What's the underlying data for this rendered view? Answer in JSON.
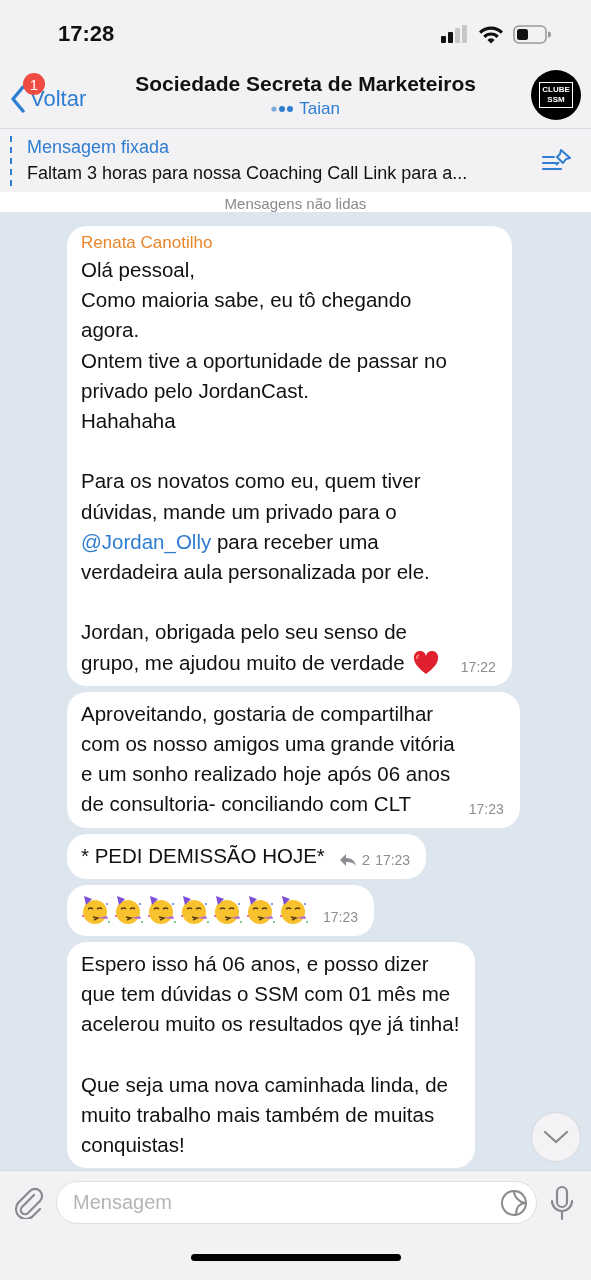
{
  "status_bar": {
    "time": "17:28"
  },
  "header": {
    "back_label": "Voltar",
    "unread_badge": "1",
    "title": "Sociedade Secreta de Marketeiros",
    "typing_user": "Taian",
    "avatar_text": "CLUBE SSM"
  },
  "pinned": {
    "label": "Mensagem fixada",
    "text": "Faltam 3 horas para nossa Coaching Call Link para a..."
  },
  "unread_divider": "Mensagens não lidas",
  "messages": [
    {
      "kind": "text",
      "sender": "Renata Canotilho",
      "paragraphs": [
        [
          {
            "kind": "plain",
            "text": "Olá pessoal,\nComo maioria sabe, eu tô chegando\nagora.\nOntem tive a oportunidade de passar no\nprivado pelo JordanCast.\nHahahaha"
          }
        ],
        [
          {
            "kind": "plain",
            "text": "Para os novatos como eu, quem tiver\ndúvidas, mande um privado para o\n"
          },
          {
            "kind": "mention",
            "text": "@Jordan_Olly"
          },
          {
            "kind": "plain",
            "text": " para receber uma\nverdadeira aula personalizada por ele."
          }
        ],
        [
          {
            "kind": "plain",
            "text": "Jordan, obrigada pelo seu senso de\ngrupo, me ajudou muito de verdade"
          }
        ]
      ],
      "trailing_emoji": {
        "kind": "heart"
      },
      "time": "17:22"
    },
    {
      "kind": "text",
      "paragraphs": [
        [
          {
            "kind": "plain",
            "text": "Aproveitando, gostaria de compartilhar\ncom os nosso amigos uma grande vitória\ne um sonho realizado hoje após 06 anos\nde consultoria- conciliando com CLT"
          }
        ]
      ],
      "time": "17:23"
    },
    {
      "kind": "text",
      "paragraphs": [
        [
          {
            "kind": "plain",
            "text": "* PEDI DEMISSÃO HOJE*"
          }
        ]
      ],
      "replies": "2",
      "time": "17:23"
    },
    {
      "kind": "emoji",
      "emojis": [
        {
          "kind": "party-face"
        },
        {
          "kind": "party-face"
        },
        {
          "kind": "party-face"
        },
        {
          "kind": "party-face"
        },
        {
          "kind": "party-face"
        },
        {
          "kind": "party-face"
        },
        {
          "kind": "party-face"
        }
      ],
      "time": "17:23"
    },
    {
      "kind": "text",
      "paragraphs": [
        [
          {
            "kind": "plain",
            "text": "Espero isso há 06 anos, e posso dizer\nque tem dúvidas o SSM com 01 mês me\nacelerou muito os resultados qye já tinha!"
          }
        ],
        [
          {
            "kind": "plain",
            "text": "Que seja uma nova caminhada linda, de\nmuito trabalho mais também de muitas\nconquistas!"
          }
        ]
      ]
    }
  ],
  "composer": {
    "placeholder": "Mensagem"
  }
}
